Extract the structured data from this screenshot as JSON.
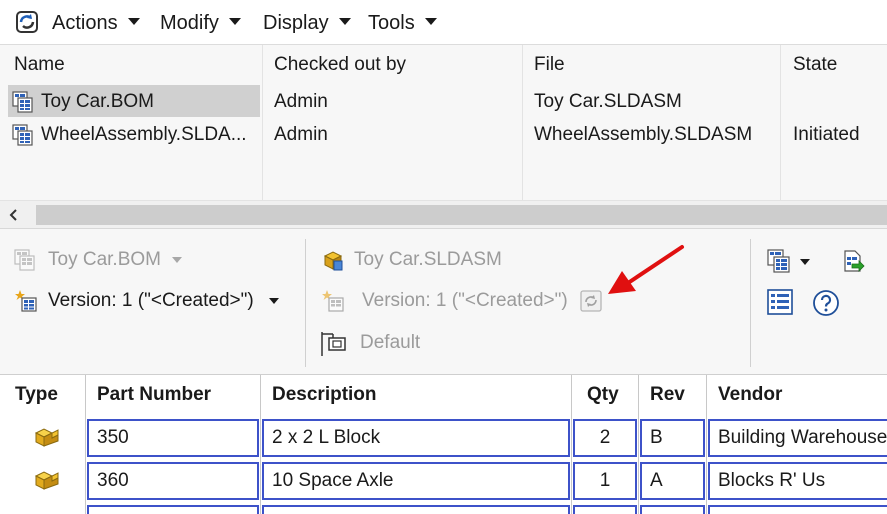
{
  "menu": {
    "actions": "Actions",
    "modify": "Modify",
    "display": "Display",
    "tools": "Tools"
  },
  "filelist": {
    "columns": {
      "name": "Name",
      "checked_out_by": "Checked out by",
      "file": "File",
      "state": "State"
    },
    "rows": [
      {
        "name": "Toy Car.BOM",
        "checked_out_by": "Admin",
        "file": "Toy Car.SLDASM",
        "state": ""
      },
      {
        "name": "WheelAssembly.SLDA...",
        "checked_out_by": "Admin",
        "file": "WheelAssembly.SLDASM",
        "state": "Initiated"
      }
    ]
  },
  "detail": {
    "bom_name": "Toy Car.BOM",
    "bom_version": "Version: 1 (\"<Created>\")",
    "ref_file": "Toy Car.SLDASM",
    "ref_version": "Version: 1 (\"<Created>\")",
    "configuration": "Default"
  },
  "bom": {
    "headers": {
      "type": "Type",
      "part_number": "Part Number",
      "description": "Description",
      "qty": "Qty",
      "rev": "Rev",
      "vendor": "Vendor"
    },
    "rows": [
      {
        "part_number": "350",
        "description": "2 x 2 L Block",
        "qty": "2",
        "rev": "B",
        "vendor": "Building Warehouse"
      },
      {
        "part_number": "360",
        "description": "10 Space Axle",
        "qty": "1",
        "rev": "A",
        "vendor": "Blocks R' Us"
      }
    ]
  },
  "colors": {
    "accent_blue": "#3d52c9",
    "annotation_arrow": "#e01010",
    "selection_gray": "#d0d0d0"
  },
  "icons": {
    "menu_logo": "vault-refresh-icon",
    "bom_doc": "bom-document-icon",
    "assembly": "assembly-icon",
    "version": "version-icon",
    "configuration": "configuration-icon",
    "part": "part-icon",
    "refresh": "refresh-icon",
    "grid": "bom-view-icon",
    "export": "export-icon",
    "help": "help-icon"
  }
}
